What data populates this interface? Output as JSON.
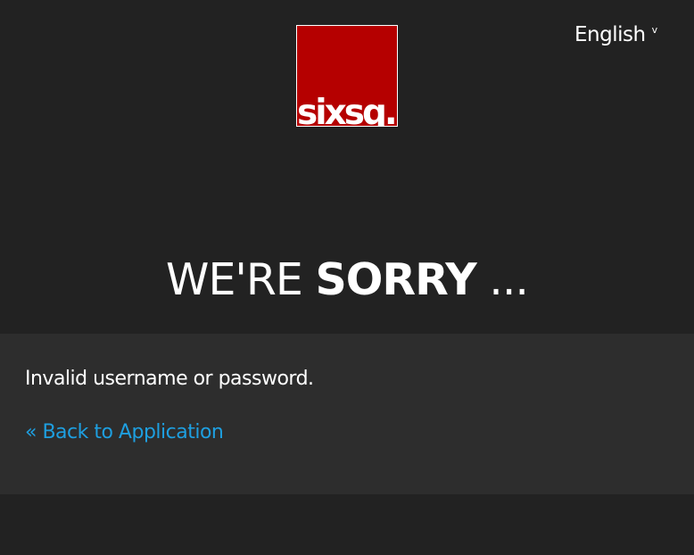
{
  "language_selector": {
    "label": "English",
    "caret": "v"
  },
  "logo": {
    "text": "sixsq.",
    "background": "#b50000"
  },
  "heading": {
    "light": "WE'RE ",
    "bold": "SORRY",
    "trailing": " ..."
  },
  "message": {
    "text": "Invalid username or password."
  },
  "back_link": {
    "text": "« Back to Application",
    "color": "#1e9fe0"
  },
  "colors": {
    "background": "#222222",
    "panel": "#2d2d2d"
  }
}
